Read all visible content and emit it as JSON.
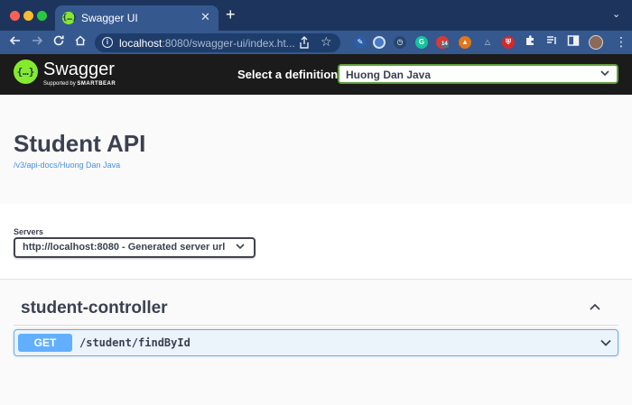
{
  "browser": {
    "tab_title": "Swagger UI",
    "tab_favicon": "{…}",
    "tab_close": "✕",
    "new_tab": "+",
    "tab_menu": "⌄",
    "url_host": "localhost",
    "url_rest": ":8080/swagger-ui/index.ht...",
    "extension_badge": "14",
    "grammarly_letter": "G",
    "icons": [
      "back-arrow-icon",
      "forward-arrow-icon",
      "reload-icon",
      "home-icon",
      "info-icon",
      "share-icon",
      "star-icon",
      "puzzle-icon",
      "sidebar-icon",
      "kebab-menu-icon"
    ]
  },
  "swagger": {
    "logo_glyph": "{…}",
    "brand": "Swagger",
    "supported_by": "Supported by",
    "smartbear": "SMARTBEAR",
    "select_label": "Select a definition",
    "selected_definition": "Huong Dan Java",
    "accent_green": "#85ea2d"
  },
  "info": {
    "title": "Student API",
    "spec_link": "/v3/api-docs/Huong Dan Java"
  },
  "servers": {
    "label": "Servers",
    "selected": "http://localhost:8080 - Generated server url"
  },
  "operations": {
    "tag": "student-controller",
    "items": [
      {
        "method": "GET",
        "path": "/student/findById",
        "color": "#61affe"
      }
    ]
  }
}
